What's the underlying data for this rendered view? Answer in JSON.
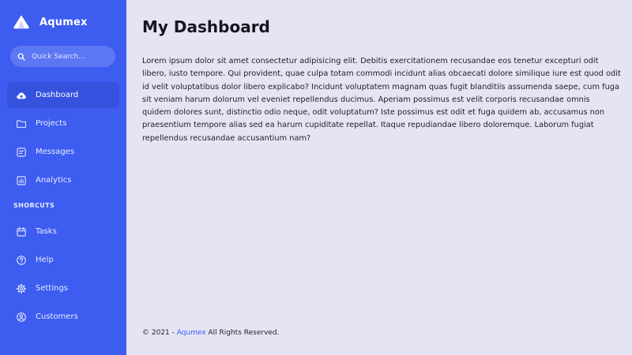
{
  "brand": {
    "name": "Aqumex",
    "logo_icon": "mountain-logo-icon"
  },
  "search": {
    "placeholder": "Quick Search..."
  },
  "nav": {
    "items": [
      {
        "label": "Dashboard",
        "icon": "cloud-icon",
        "active": true
      },
      {
        "label": "Projects",
        "icon": "folder-icon",
        "active": false
      },
      {
        "label": "Messages",
        "icon": "message-icon",
        "active": false
      },
      {
        "label": "Analytics",
        "icon": "chart-icon",
        "active": false
      }
    ]
  },
  "shortcuts": {
    "heading": "SHORCUTS",
    "items": [
      {
        "label": "Tasks",
        "icon": "calendar-icon"
      },
      {
        "label": "Help",
        "icon": "help-icon"
      },
      {
        "label": "Settings",
        "icon": "gear-icon"
      },
      {
        "label": "Customers",
        "icon": "user-icon"
      }
    ]
  },
  "main": {
    "title": "My Dashboard",
    "body": "Lorem ipsum dolor sit amet consectetur adipisicing elit. Debitis exercitationem recusandae eos tenetur excepturi odit libero, iusto tempore. Qui provident, quae culpa totam commodi incidunt alias obcaecati dolore similique iure est quod odit id velit voluptatibus dolor libero explicabo? Incidunt voluptatem magnam quas fugit blanditiis assumenda saepe, cum fuga sit veniam harum dolorum vel eveniet repellendus ducimus. Aperiam possimus est velit corporis recusandae omnis quidem dolores sunt, distinctio odio neque, odit voluptatum? Iste possimus est odit et fuga quidem ab, accusamus non praesentium tempore alias sed ea harum cupiditate repellat. Itaque repudiandae libero doloremque. Laborum fugiat repellendus recusandae accusantium nam?"
  },
  "footer": {
    "prefix": "© 2021 - ",
    "brand_link": "Aqumex",
    "suffix": " All Rights Reserved."
  },
  "colors": {
    "sidebar": "#3d5cf0",
    "sidebar_active": "#3452dd",
    "search_bg": "#5b77f4",
    "page_bg": "#e4e4f4",
    "link": "#3d5cf0"
  }
}
